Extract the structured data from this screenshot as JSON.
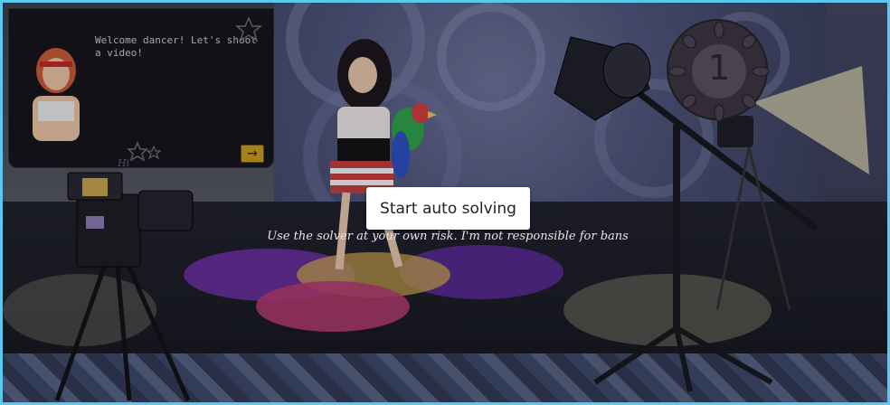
{
  "dialog": {
    "message": "Welcome dancer! Let's shoot a video!",
    "avatar": "dancer-instructor-avatar",
    "next_button": "→",
    "signature": "Hi"
  },
  "timer": {
    "value": "1"
  },
  "actions": {
    "start_label": "Start auto solving"
  },
  "notice": {
    "text": "Use the solver at your own risk. I'm not responsible for bans"
  },
  "colors": {
    "frame_border": "#5cc8f0",
    "spot_purple": "#6a2fa0",
    "spot_pink": "#b23a6e",
    "spot_yellow": "#c8a24a",
    "button_bg": "#ffffff"
  },
  "icons": [
    "camera-icon",
    "spotlight-icon",
    "umbrella-light-icon",
    "star-icon",
    "arrow-right-icon",
    "parrot-icon"
  ]
}
